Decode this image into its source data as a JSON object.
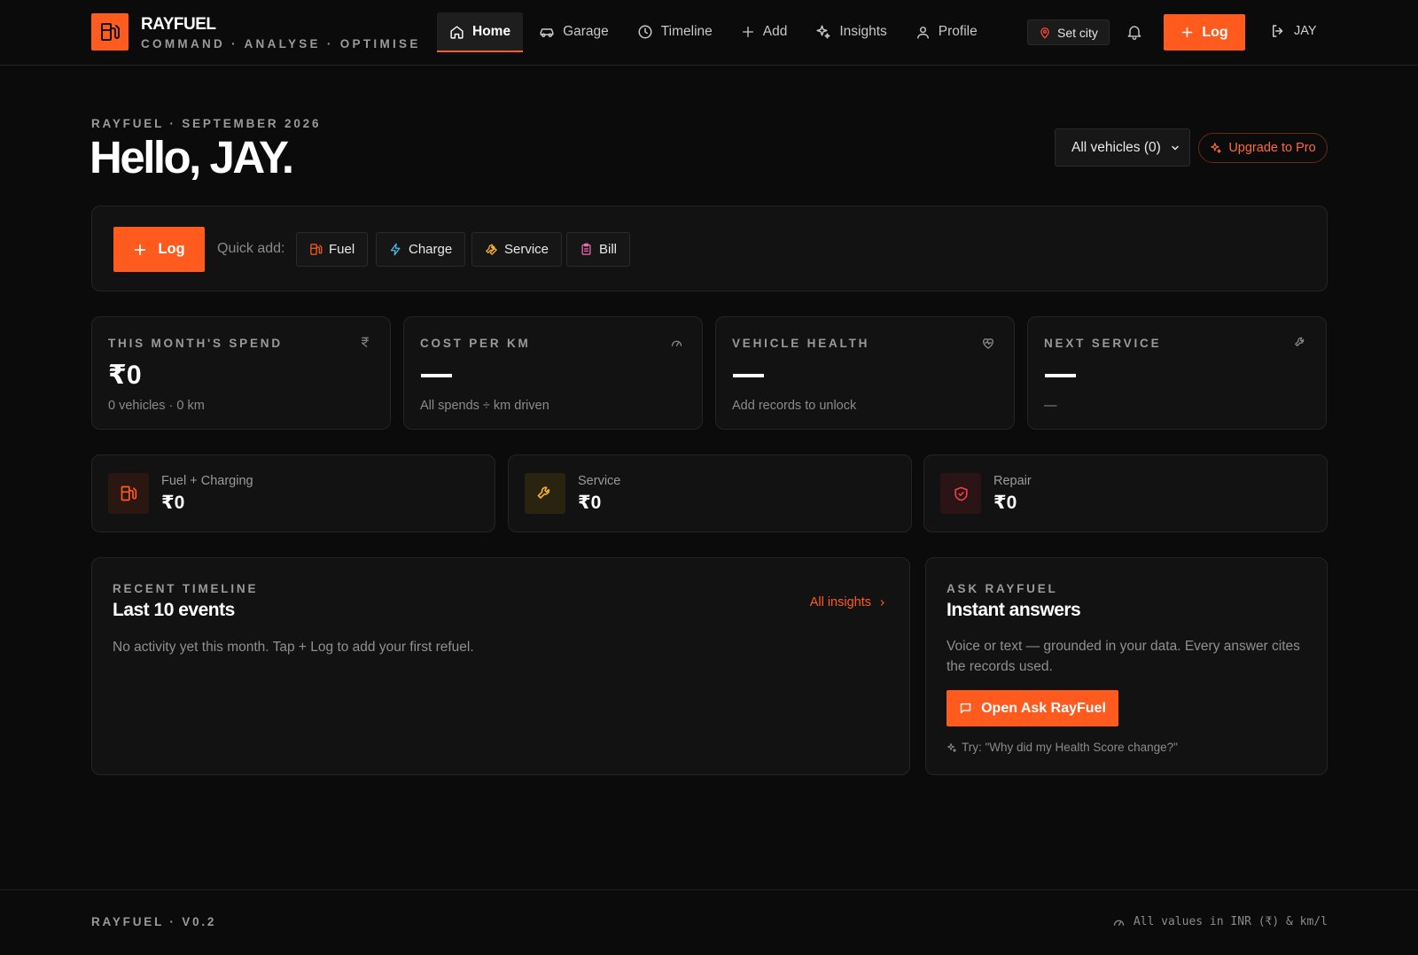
{
  "brand": {
    "name": "RAYFUEL",
    "tagline": "COMMAND · ANALYSE · OPTIMISE",
    "accent": "#ff5b1f"
  },
  "nav": {
    "items": [
      {
        "label": "Home",
        "icon": "home-icon",
        "active": true
      },
      {
        "label": "Garage",
        "icon": "car-icon"
      },
      {
        "label": "Timeline",
        "icon": "clock-icon"
      },
      {
        "label": "Add",
        "icon": "plus-icon"
      },
      {
        "label": "Insights",
        "icon": "sparkle-icon"
      },
      {
        "label": "Profile",
        "icon": "user-icon"
      }
    ],
    "city_label": "Set city",
    "log_label": "Log",
    "user_label": "JAY"
  },
  "header": {
    "eyebrow": "RAYFUEL · SEPTEMBER 2026",
    "greeting": "Hello, JAY.",
    "vehicle_select": "All vehicles (0)",
    "upgrade_label": "Upgrade to Pro"
  },
  "quick": {
    "log_label": "Log",
    "label": "Quick add:",
    "chips": [
      {
        "label": "Fuel",
        "icon": "fuel-pump-icon",
        "color": "#ff5b1f"
      },
      {
        "label": "Charge",
        "icon": "lightning-icon",
        "color": "#3ec3e8"
      },
      {
        "label": "Service",
        "icon": "wrench-icon",
        "color": "#f2b134"
      },
      {
        "label": "Bill",
        "icon": "clipboard-icon",
        "color": "#f26bb4"
      }
    ]
  },
  "stats": [
    {
      "title": "THIS MONTH'S SPEND",
      "value": "₹0",
      "sub": "0 vehicles · 0 km",
      "icon": "rupee-icon"
    },
    {
      "title": "COST PER KM",
      "value": "",
      "sub": "All spends ÷ km driven",
      "icon": "gauge-icon"
    },
    {
      "title": "VEHICLE HEALTH",
      "value": "",
      "sub": "Add records to unlock",
      "icon": "heart-pulse-icon"
    },
    {
      "title": "NEXT SERVICE",
      "value": "",
      "sub": "—",
      "icon": "wrench-icon"
    }
  ],
  "categories": [
    {
      "label": "Fuel + Charging",
      "value": "₹0",
      "icon": "fuel-pump-icon",
      "color": "#ff5b1f"
    },
    {
      "label": "Service",
      "value": "₹0",
      "icon": "wrench-icon",
      "color": "#f2b134"
    },
    {
      "label": "Repair",
      "value": "₹0",
      "icon": "shield-icon",
      "color": "#f0444a"
    }
  ],
  "timeline": {
    "eyebrow": "RECENT TIMELINE",
    "title": "Last 10 events",
    "link": "All insights",
    "empty": "No activity yet this month. Tap + Log to add your first refuel."
  },
  "ask": {
    "eyebrow": "ASK RAYFUEL",
    "title": "Instant answers",
    "desc": "Voice or text — grounded in your data. Every answer cites the records used.",
    "button": "Open Ask RayFuel",
    "try": "Try: \"Why did my Health Score change?\""
  },
  "footer": {
    "version": "RAYFUEL · V0.2",
    "note": "All values in INR (₹) & km/l"
  }
}
